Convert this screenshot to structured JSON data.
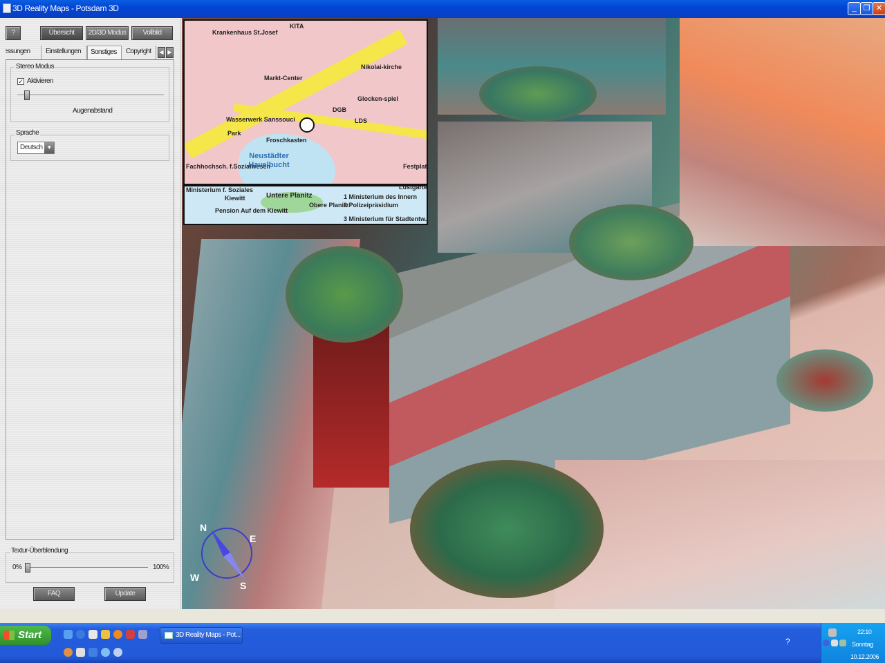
{
  "window": {
    "title": "3D Reality Maps - Potsdam 3D",
    "min_glyph": "_",
    "max_glyph": "❐",
    "close_glyph": "✕"
  },
  "toolbar": {
    "help_label": "?",
    "overview_label": "Übersicht",
    "mode_label": "2D/3D Modus",
    "fullscreen_label": "Vollbild"
  },
  "tabs": [
    {
      "label": "Messungen"
    },
    {
      "label": "Einstellungen"
    },
    {
      "label": "Sonstiges"
    },
    {
      "label": "Copyright"
    }
  ],
  "tab_scroll": {
    "left": "◀",
    "right": "▶"
  },
  "stereo": {
    "group_label": "Stereo Modus",
    "checkbox_label": "Aktivieren",
    "checked_glyph": "✓",
    "slider_label": "Augenabstand",
    "slider_value": 0.05
  },
  "language": {
    "group_label": "Sprache",
    "selected": "Deutsch",
    "arrow": "▼"
  },
  "texture": {
    "group_label": "Textur-Überblendung",
    "min_label": "0%",
    "max_label": "100%",
    "slider_value": 0.0
  },
  "buttons": {
    "faq": "FAQ",
    "update": "Update"
  },
  "minimap": {
    "labels": [
      "Krankenhaus St.Josef",
      "KITA",
      "Markt-Center",
      "Nikolai-kirche",
      "Glocken-spiel",
      "DGB",
      "LDS",
      "Wasserwerk Sanssouci",
      "Park",
      "Froschkasten",
      "Fachhochsch. f.Sozialwesen",
      "Festplatz",
      "Lustgarten",
      "Ministerium f. Soziales",
      "Kiewitt",
      "Pension Auf dem Kiewitt",
      "Obere Planitz",
      "1 Ministerium des Innern",
      "2 Polizeipräsidium",
      "3 Ministerium für Stadtentw."
    ],
    "lake_name": "Neustädter Havelbucht",
    "island_name": "Untere Planitz"
  },
  "compass": {
    "n": "N",
    "e": "E",
    "s": "S",
    "w": "W"
  },
  "taskbar": {
    "start_label": "Start",
    "task_label": "3D Reality Maps - Pot...",
    "help_glyph": "?",
    "time": "22:10",
    "day": "Sonntag",
    "date": "10.12.2006"
  },
  "colors": {
    "titlebar": "#0245d6",
    "start_button": "#2f8f2c",
    "taskbar": "#245edc"
  }
}
